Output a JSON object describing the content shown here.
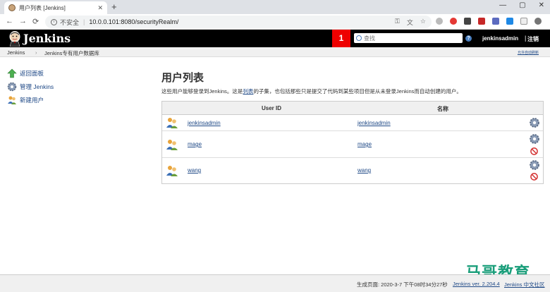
{
  "browser": {
    "tab_title": "用户列表 [Jenkins]",
    "new_tab": "+",
    "minimize": "—",
    "maximize": "▢",
    "close": "✕",
    "back": "←",
    "forward": "→",
    "reload": "⟳",
    "insecure_label": "不安全",
    "url": "10.0.0.101:8080/securityRealm/"
  },
  "header": {
    "logo_text": "Jenkins",
    "notification_count": "1",
    "search_placeholder": "查找",
    "help_label": "?",
    "username": "jenkinsadmin",
    "logout": "注销",
    "logout_sep": "|"
  },
  "breadcrumb": {
    "root": "Jenkins",
    "sep": "›",
    "current": "Jenkins专有用户数据库",
    "auto_refresh": "允许自动刷新"
  },
  "sidebar": {
    "items": [
      {
        "label": "返回面板",
        "icon": "up-arrow-icon"
      },
      {
        "label": "管理 Jenkins",
        "icon": "gear-icon"
      },
      {
        "label": "新建用户",
        "icon": "new-user-icon"
      }
    ]
  },
  "main": {
    "title": "用户列表",
    "desc_before": "这些用户能够登录到Jenkins。这是",
    "desc_link": "列表",
    "desc_after": "的子集，也包括那些只是提交了代码到某些项目但是从未登录Jenkins而自动创建的用户。",
    "col_userid": "User ID",
    "col_name": "名称",
    "users": [
      {
        "id": "jenkinsadmin",
        "name": "jenkinsadmin",
        "deletable": false
      },
      {
        "id": "mage",
        "name": "mage",
        "deletable": true
      },
      {
        "id": "wang",
        "name": "wang",
        "deletable": true
      }
    ]
  },
  "footer": {
    "generated": "生成页面: 2020-3-7 下午08时34分27秒",
    "version": "Jenkins ver. 2.204.4",
    "community": "Jenkins 中文社区"
  },
  "watermark": "马哥教育"
}
